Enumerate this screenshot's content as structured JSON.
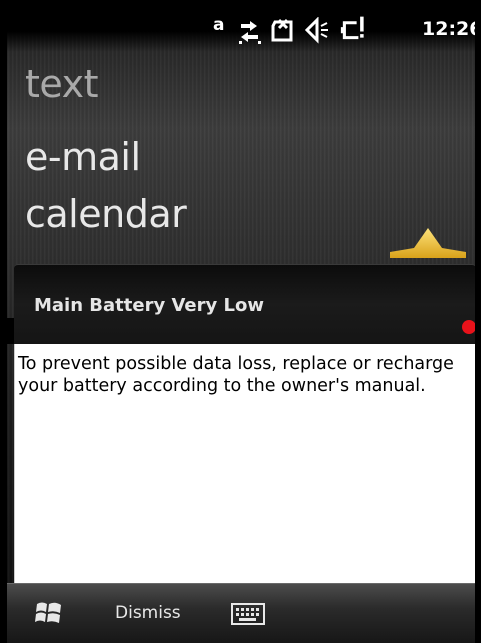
{
  "status_bar": {
    "network_letter": "a",
    "time": "12:26",
    "icons": [
      "data-sync-icon",
      "no-sim-icon",
      "speaker-icon",
      "low-battery-icon"
    ]
  },
  "start_menu": {
    "items": [
      {
        "label": "text"
      },
      {
        "label": "e-mail"
      },
      {
        "label": "calendar"
      }
    ]
  },
  "notification": {
    "title": "Main Battery Very Low",
    "message": "To prevent possible data loss, replace or recharge your battery according to the owner's manual."
  },
  "softkey_bar": {
    "dismiss_label": "Dismiss"
  },
  "colors": {
    "accent_arrow": "#f2c63a",
    "alert_dot": "#e8121a"
  }
}
